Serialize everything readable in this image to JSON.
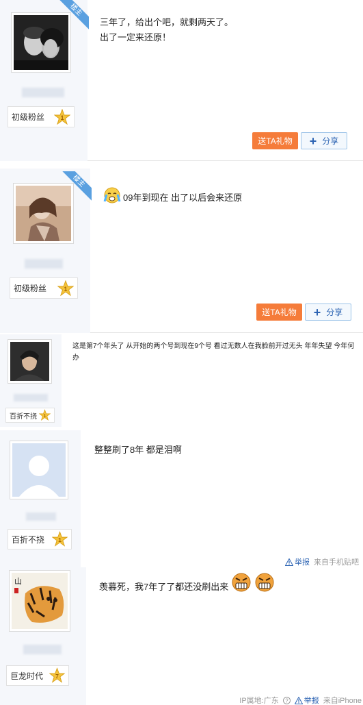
{
  "owner_badge": "楼主",
  "posts": [
    {
      "level_name": "初级粉丝",
      "level_num": "1",
      "lines": [
        "三年了，给出个吧，就剩两天了。",
        "出了一定来还原！"
      ],
      "gift_label": "送TA礼物",
      "share_label": "分享"
    },
    {
      "level_name": "初级粉丝",
      "level_num": "1",
      "lines": [
        "09年到现在 出了以后会来还原"
      ],
      "gift_label": "送TA礼物",
      "share_label": "分享"
    },
    {
      "level_name": "百折不挠",
      "level_num": "1",
      "lines": [
        "这是第7个年头了 从开始的两个号到现在9个号 看过无数人在我脸前开过无头 年年失望 今年何办"
      ]
    },
    {
      "level_name": "百折不挠",
      "level_num": "1",
      "lines": [
        "整整刷了8年 都是泪啊"
      ],
      "report_label": "举报",
      "source_label": "来自手机贴吧"
    },
    {
      "level_name": "巨龙时代",
      "level_num": "7",
      "lines": [
        "羡慕死，我7年了了都还没刷出来"
      ],
      "ip_label": "IP属地:广东",
      "report_label": "举报",
      "source_label": "来自iPhone"
    }
  ],
  "colors": {
    "accent": "#f57c3a",
    "link": "#2d64b3",
    "badge": "#5aa0e0",
    "sidebar": "#f5f7fb"
  }
}
